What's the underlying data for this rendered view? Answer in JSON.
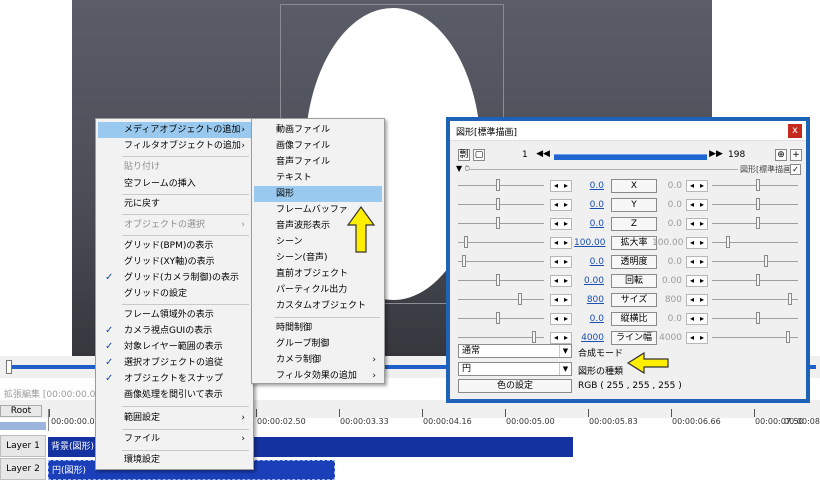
{
  "timeline": {
    "title": "拡張編集 [00:00:00.00] [1/198]",
    "root_label": "Root",
    "ticks": [
      "00:00:00.00",
      "00:00:02.50",
      "00:00:03.33",
      "00:00:04.16",
      "00:00:05.00",
      "00:00:05.83",
      "00:00:06.66",
      "00:00:07.50",
      "00:00:08.33"
    ],
    "layers": [
      {
        "label": "Layer 1",
        "clip": "背景(図形)"
      },
      {
        "label": "Layer 2",
        "clip": "円(図形)"
      }
    ]
  },
  "context_menu": {
    "items": [
      {
        "label": "メディアオブジェクトの追加",
        "arrow": "›",
        "highlighted": true
      },
      {
        "label": "フィルタオブジェクトの追加",
        "arrow": "›"
      },
      {
        "label": "貼り付け",
        "disabled": true
      },
      {
        "label": "空フレームの挿入"
      },
      {
        "label": "元に戻す"
      },
      {
        "label": "オブジェクトの選択",
        "arrow": "›",
        "disabled": true
      },
      {
        "label": "グリッド(BPM)の表示"
      },
      {
        "label": "グリッド(XY軸)の表示"
      },
      {
        "label": "グリッド(カメラ制御)の表示",
        "checked": true
      },
      {
        "label": "グリッドの設定"
      },
      {
        "label": "フレーム領域外の表示"
      },
      {
        "label": "カメラ視点GUIの表示",
        "checked": true
      },
      {
        "label": "対象レイヤー範囲の表示",
        "checked": true
      },
      {
        "label": "選択オブジェクトの追従",
        "checked": true
      },
      {
        "label": "オブジェクトをスナップ",
        "checked": true
      },
      {
        "label": "画像処理を間引いて表示"
      },
      {
        "label": "範囲設定",
        "arrow": "›"
      },
      {
        "label": "ファイル",
        "arrow": "›"
      },
      {
        "label": "環境設定"
      }
    ],
    "check_mark": "✓"
  },
  "sub_menu": {
    "items": [
      {
        "label": "動画ファイル"
      },
      {
        "label": "画像ファイル"
      },
      {
        "label": "音声ファイル"
      },
      {
        "label": "テキスト"
      },
      {
        "label": "図形",
        "highlighted": true
      },
      {
        "label": "フレームバッファ"
      },
      {
        "label": "音声波形表示"
      },
      {
        "label": "シーン"
      },
      {
        "label": "シーン(音声)"
      },
      {
        "label": "直前オブジェクト"
      },
      {
        "label": "パーティクル出力"
      },
      {
        "label": "カスタムオブジェクト"
      },
      {
        "label": "時間制御"
      },
      {
        "label": "グループ制御"
      },
      {
        "label": "カメラ制御",
        "arrow": "›"
      },
      {
        "label": "フィルタ効果の追加",
        "arrow": "›"
      }
    ]
  },
  "dialog": {
    "title": "図形[標準描画]",
    "close": "x",
    "frame_current": "1",
    "frame_total": "198",
    "prev": "◀◀",
    "next": "▶▶",
    "left_icons": [
      "剽",
      "▢"
    ],
    "right_icons": [
      "⊕",
      "+"
    ],
    "effect_name": "図形[標準描画]",
    "effect_check": "✓",
    "collapse": "▼ ⍥",
    "params": [
      {
        "name": "X",
        "left": "0.0",
        "right": "0.0",
        "dim_right": true
      },
      {
        "name": "Y",
        "left": "0.0",
        "right": "0.0",
        "dim_right": true
      },
      {
        "name": "Z",
        "left": "0.0",
        "right": "0.0",
        "dim_right": true
      },
      {
        "name": "拡大率",
        "left": "100.00",
        "right": "100.00",
        "dim_right": true
      },
      {
        "name": "透明度",
        "left": "0.0",
        "right": "0.0",
        "dim_right": true
      },
      {
        "name": "回転",
        "left": "0.00",
        "right": "0.00",
        "dim_right": true
      },
      {
        "name": "サイズ",
        "left": "800",
        "right": "800",
        "dim_right": true
      },
      {
        "name": "縦横比",
        "left": "0.0",
        "right": "0.0",
        "dim_right": true
      },
      {
        "name": "ライン幅",
        "left": "4000",
        "right": "4000",
        "dim_right": true
      }
    ],
    "spin_left": "◂",
    "spin_right": "▸",
    "blend_value": "通常",
    "blend_label": "合成モード",
    "shape_value": "円",
    "shape_label": "図形の種類",
    "color_button": "色の設定",
    "rgb_text": "RGB ( 255 , 255 , 255 )"
  },
  "colors": {
    "highlight": "#99c9ef",
    "accent_blue": "#1e63b8",
    "clip_blue": "#1432a0",
    "arrow_yellow": "#ffee00"
  }
}
